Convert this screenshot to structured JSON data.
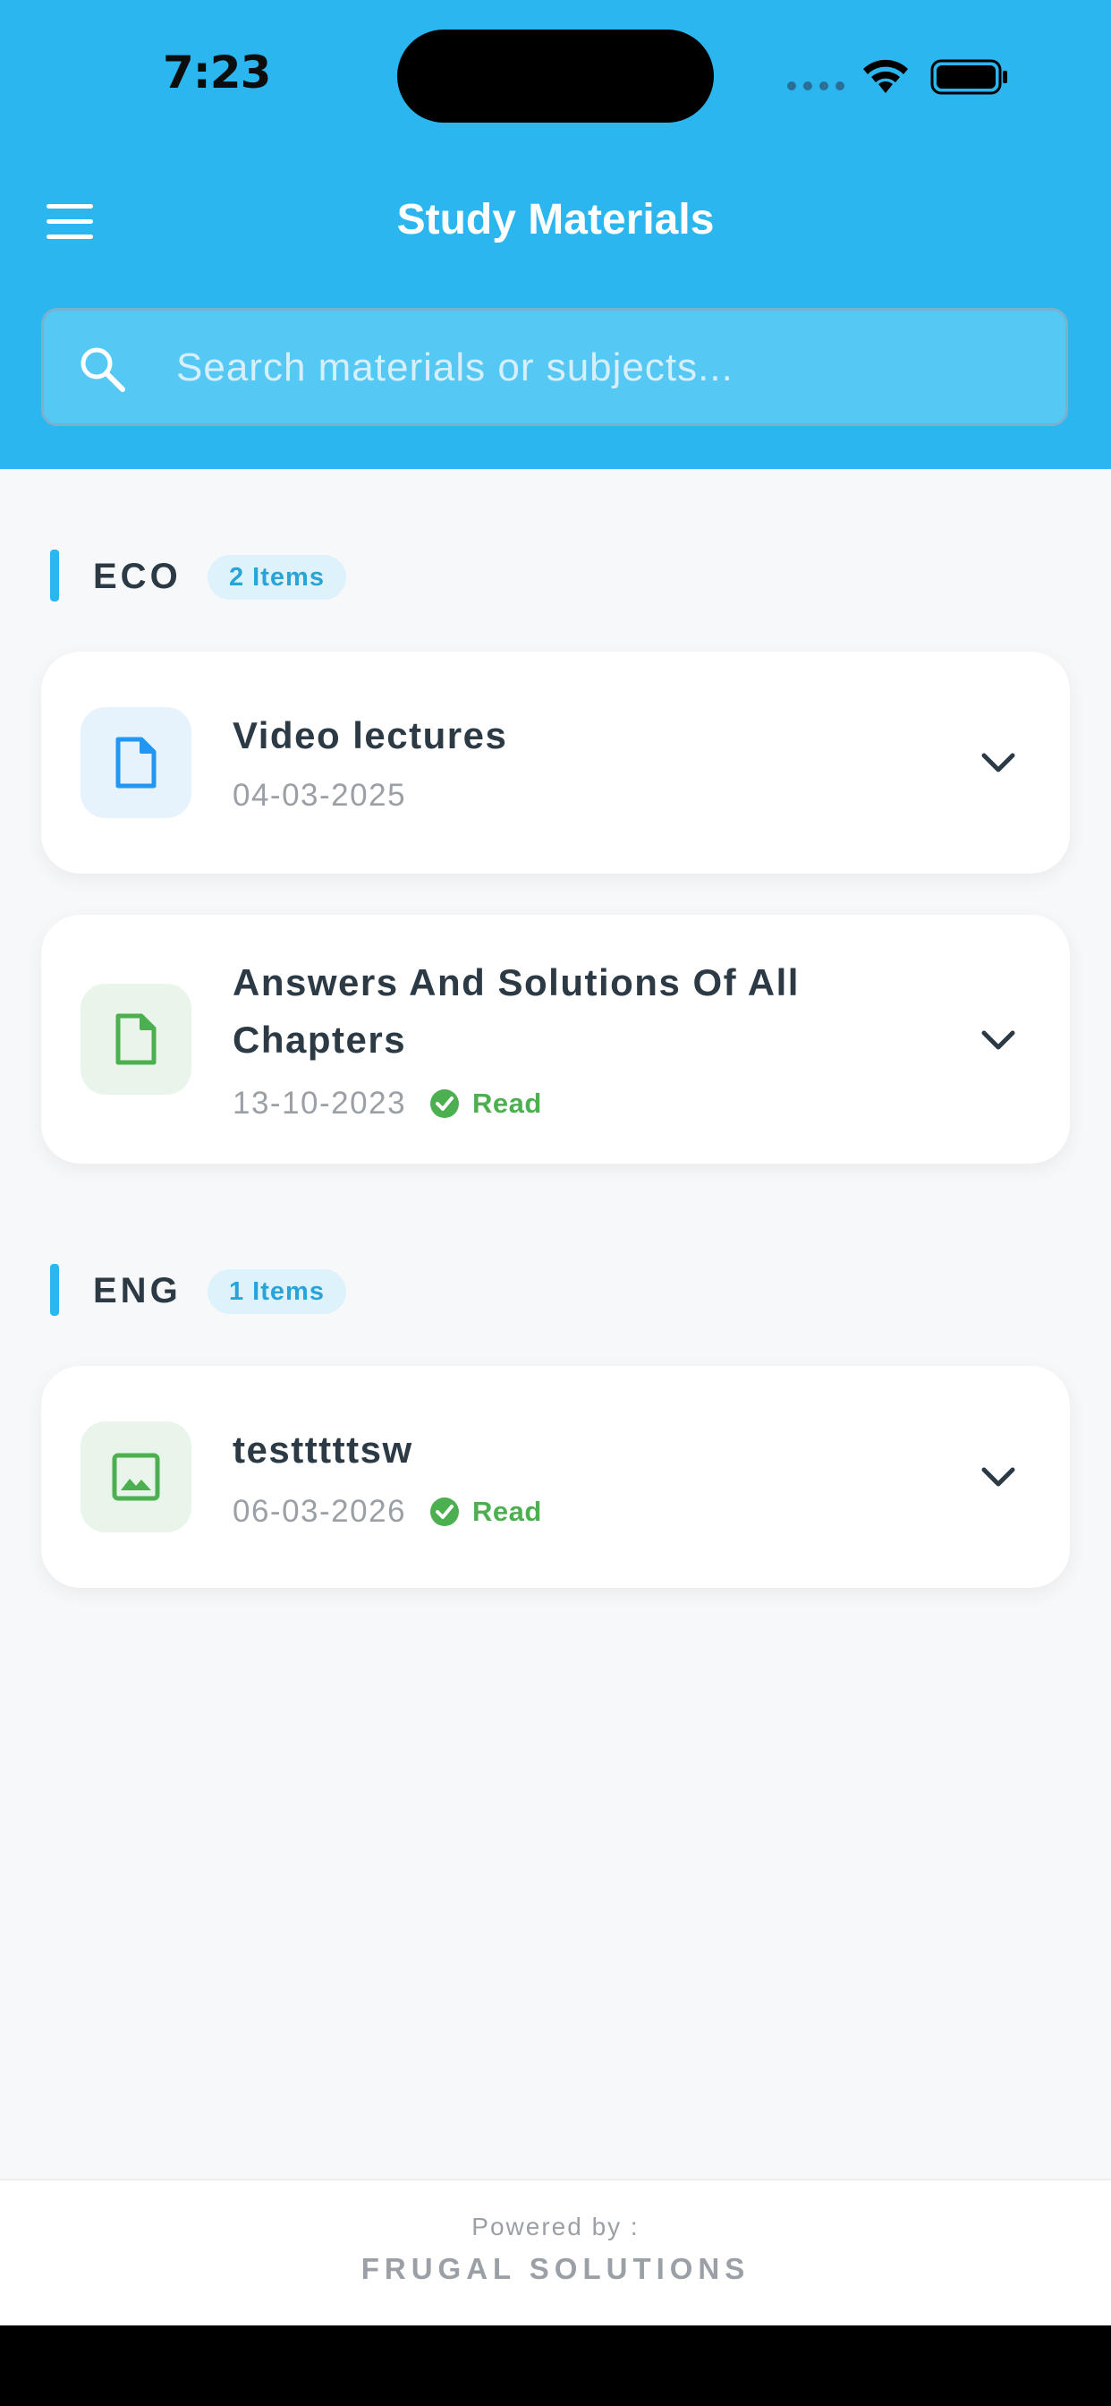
{
  "status_bar": {
    "time": "7:23",
    "icons": [
      "signal-icon",
      "wifi-icon",
      "battery-icon"
    ]
  },
  "header": {
    "title": "Study Materials",
    "menu_icon": "menu-icon",
    "background_color": "#2bb6f0"
  },
  "search": {
    "placeholder": "Search materials or subjects...",
    "value": ""
  },
  "sections": [
    {
      "name": "ECO",
      "badge": "2 Items",
      "items": [
        {
          "title": "Video lectures",
          "date": "04-03-2025",
          "icon": "document-icon",
          "icon_color": "#2196f3"
        },
        {
          "title": "Answers And Solutions Of All Chapters",
          "date": "13-10-2023",
          "status": "Read",
          "icon": "document-icon",
          "icon_color": "#4caf50"
        }
      ]
    },
    {
      "name": "ENG",
      "badge": "1 Items",
      "items": [
        {
          "title": "testttttsw",
          "date": "06-03-2026",
          "status": "Read",
          "icon": "image-icon",
          "icon_color": "#4caf50"
        }
      ]
    }
  ],
  "footer": {
    "powered_by": "Powered by :",
    "company": "FRUGAL SOLUTIONS"
  }
}
